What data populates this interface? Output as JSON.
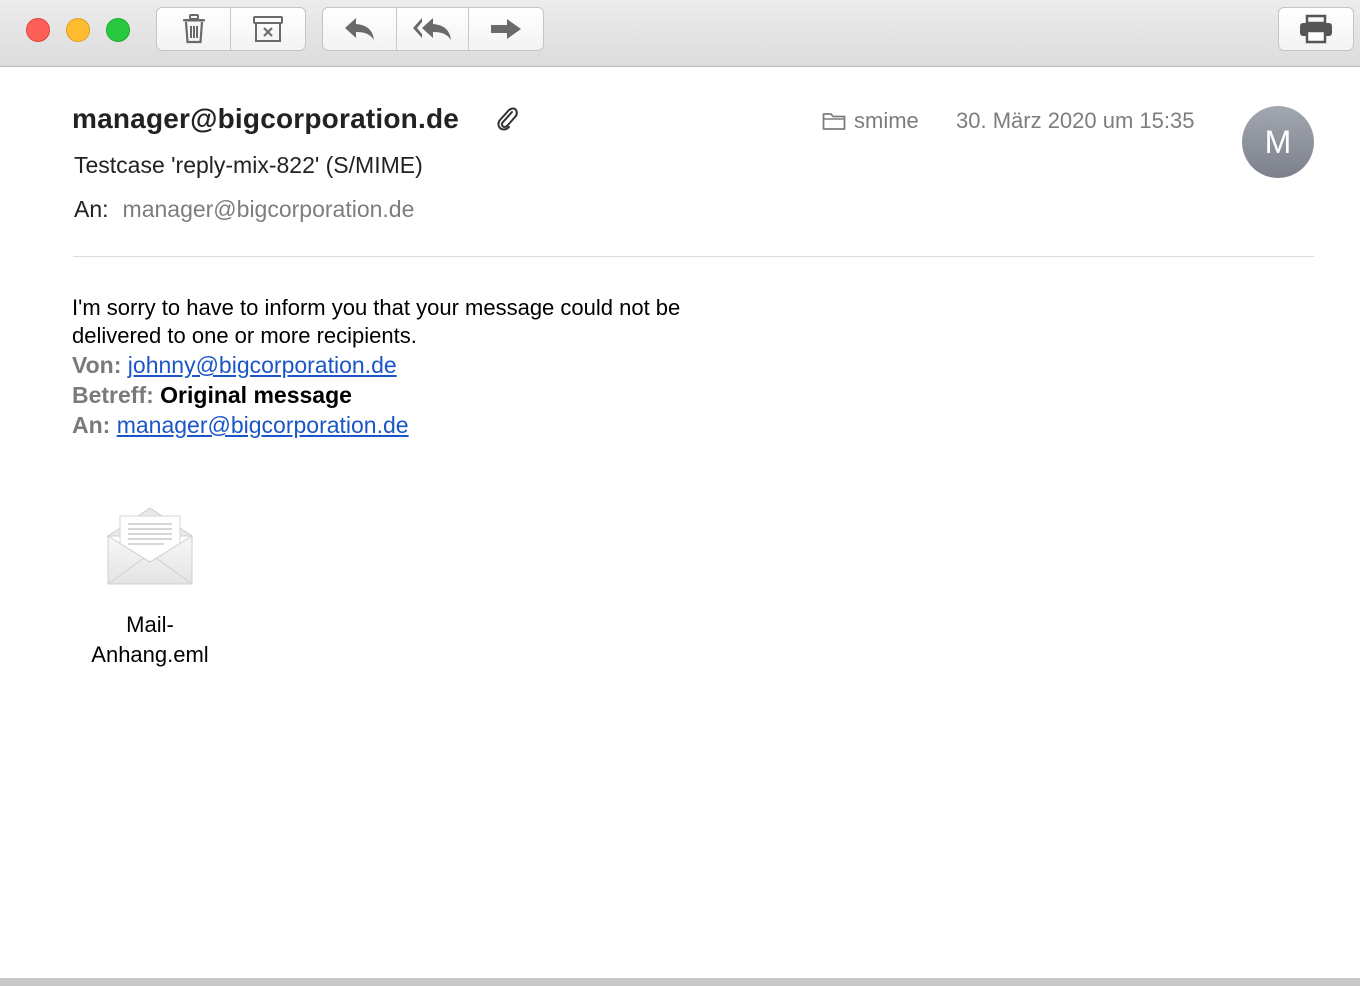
{
  "toolbar": {
    "delete_icon": "trash-icon",
    "archive_icon": "archive-icon",
    "reply_icon": "reply-icon",
    "reply_all_icon": "reply-all-icon",
    "forward_icon": "forward-icon",
    "print_icon": "printer-icon"
  },
  "header": {
    "sender": "manager@bigcorporation.de",
    "folder": "smime",
    "date": "30. März 2020 um 15:35",
    "avatar_initial": "M",
    "subject": "Testcase 'reply-mix-822' (S/MIME)",
    "to_label": "An:",
    "to_value": "manager@bigcorporation.de"
  },
  "body": {
    "text": "I'm sorry to have to inform you that your message could not be delivered to one or more recipients.",
    "from_label": "Von:",
    "from_value": "johnny@bigcorporation.de",
    "subject_label": "Betreff:",
    "subject_value": "Original message",
    "to_label": "An:",
    "to_value": "manager@bigcorporation.de"
  },
  "attachment": {
    "name_line1": "Mail-",
    "name_line2": "Anhang.eml"
  },
  "colors": {
    "link": "#1a56c8",
    "muted": "#7d7d7d",
    "close": "#fe5f57",
    "minimize": "#febc2e",
    "maximize": "#28c840"
  }
}
